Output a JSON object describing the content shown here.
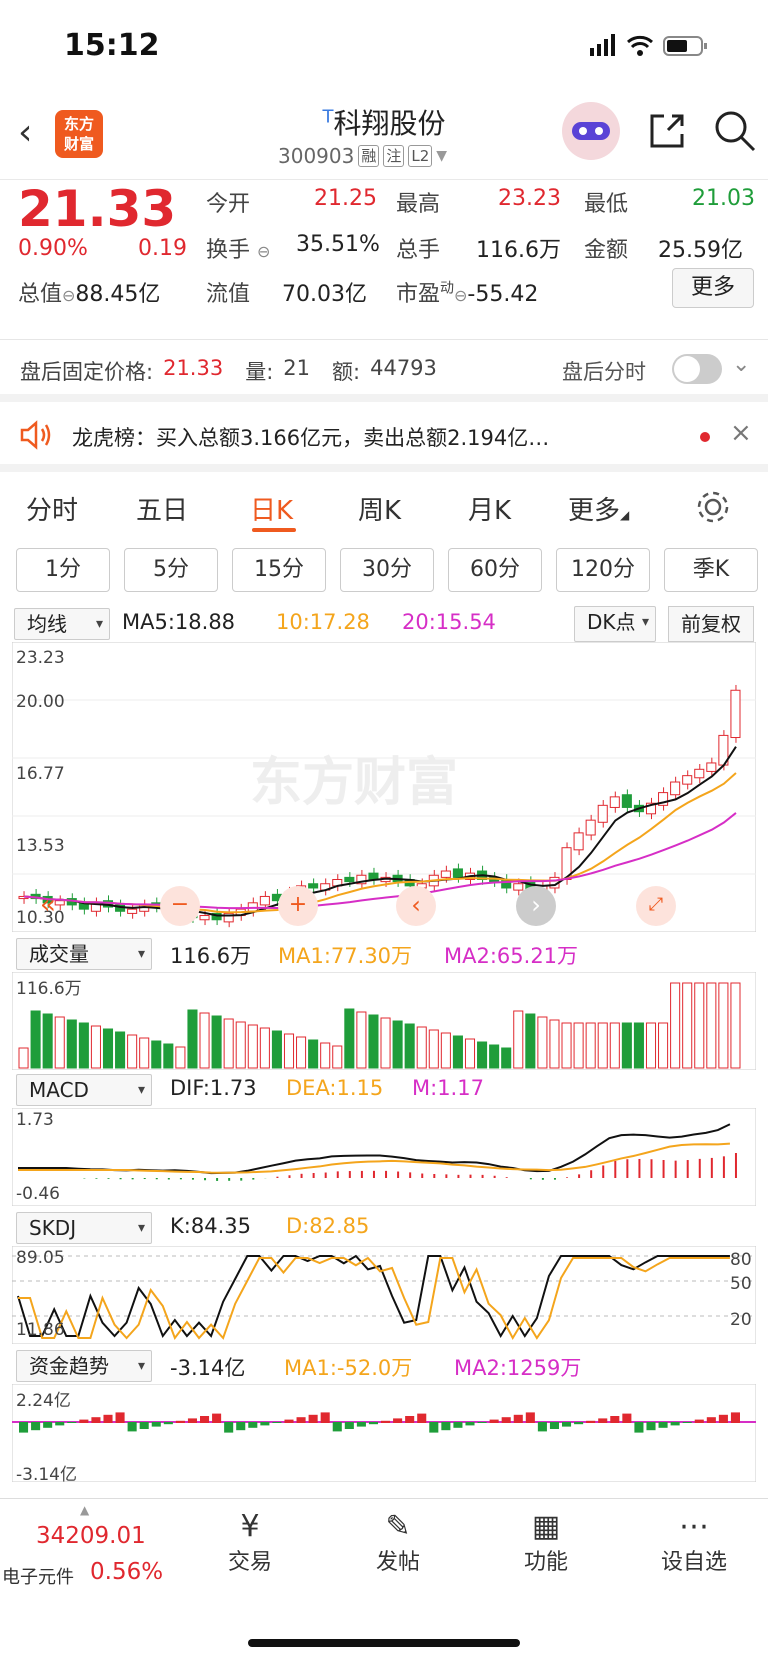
{
  "status": {
    "time": "15:12"
  },
  "header": {
    "logo_line1": "东方",
    "logo_line2": "财富",
    "name": "科翔股份",
    "name_prefix": "T",
    "code": "300903",
    "tags": [
      "融",
      "注",
      "L2"
    ]
  },
  "quote": {
    "price": "21.33",
    "pct": "0.90%",
    "chg": "0.19",
    "open_label": "今开",
    "open": "21.25",
    "high_label": "最高",
    "high": "23.23",
    "low_label": "最低",
    "low": "21.03",
    "turnover_label": "换手",
    "turnover": "35.51%",
    "vol_label": "总手",
    "vol": "116.6万",
    "amount_label": "金额",
    "amount": "25.59亿",
    "mcap_label": "总值",
    "mcap": "88.45亿",
    "float_label": "流值",
    "float": "70.03亿",
    "pe_label": "市盈",
    "pe_sup": "动",
    "pe": "-55.42",
    "more": "更多"
  },
  "after": {
    "label": "盘后固定价格:",
    "price": "21.33",
    "vol_label": "量:",
    "vol": "21",
    "amt_label": "额:",
    "amt": "44793",
    "switch_label": "盘后分时"
  },
  "banner": {
    "text": "龙虎榜：买入总额3.166亿元，卖出总额2.194亿…"
  },
  "periods": [
    "分时",
    "五日",
    "日K",
    "周K",
    "月K",
    "更多"
  ],
  "intervals": [
    "1分",
    "5分",
    "15分",
    "30分",
    "60分",
    "120分",
    "季K"
  ],
  "main": {
    "selector": "均线",
    "ma5": "MA5:18.88",
    "ma10": "10:17.28",
    "ma20": "20:15.54",
    "dk": "DK点",
    "fq": "前复权",
    "ticks": [
      "23.23",
      "20.00",
      "16.77",
      "13.53",
      "10.30"
    ],
    "watermark": "东方财富"
  },
  "vol": {
    "selector": "成交量",
    "val": "116.6万",
    "ma1": "MA1:77.30万",
    "ma2": "MA2:65.21万",
    "tick": "116.6万"
  },
  "macd": {
    "selector": "MACD",
    "dif": "DIF:1.73",
    "dea": "DEA:1.15",
    "m": "M:1.17",
    "t1": "1.73",
    "t2": "-0.46"
  },
  "skdj": {
    "selector": "SKDJ",
    "k": "K:84.35",
    "d": "D:82.85",
    "t1": "89.05",
    "t2": "11.86",
    "r1": "80",
    "r2": "50",
    "r3": "20"
  },
  "fund": {
    "selector": "资金趋势",
    "val": "-3.14亿",
    "ma1": "MA1:-52.0万",
    "ma2": "MA2:1259万",
    "t1": "2.24亿",
    "t2": "-3.14亿"
  },
  "nav": {
    "index_val": "34209.01",
    "index_name": "电子元件",
    "index_pct": "0.56%",
    "items": [
      "交易",
      "发帖",
      "功能",
      "设自选"
    ]
  },
  "colors": {
    "up": "#e0282f",
    "down": "#1f9d3a",
    "ma10": "#f4a51c",
    "ma20": "#d62ec6"
  },
  "chart_data": {
    "type": "candlestick",
    "closes": [
      11.6,
      11.5,
      11.3,
      11.4,
      11.2,
      11.0,
      11.3,
      11.1,
      10.9,
      11.0,
      11.2,
      11.1,
      10.8,
      10.9,
      10.6,
      10.7,
      10.5,
      10.8,
      11.0,
      11.3,
      11.6,
      11.4,
      11.8,
      12.1,
      12.0,
      12.2,
      12.4,
      12.3,
      12.6,
      12.4,
      12.5,
      12.3,
      12.1,
      12.2,
      12.6,
      12.8,
      12.5,
      12.7,
      12.4,
      12.3,
      12.0,
      12.2,
      11.9,
      12.1,
      12.5,
      13.9,
      14.6,
      15.2,
      15.9,
      16.3,
      15.8,
      15.6,
      16.0,
      16.5,
      17.0,
      17.3,
      17.6,
      17.9,
      19.2,
      21.33
    ],
    "ylim": [
      10.3,
      23.23
    ]
  }
}
